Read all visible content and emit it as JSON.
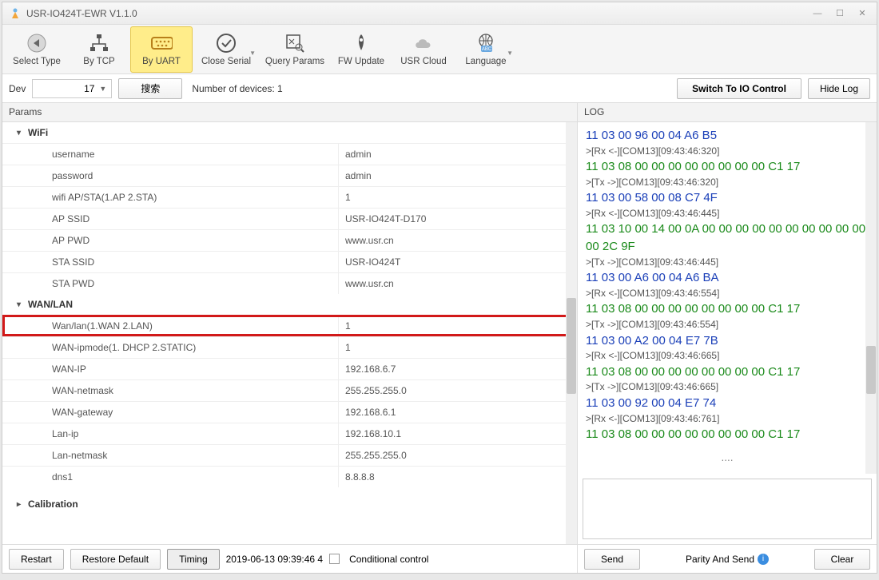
{
  "window": {
    "title": "USR-IO424T-EWR V1.1.0"
  },
  "ribbon": {
    "select_type": "Select Type",
    "by_tcp": "By TCP",
    "by_uart": "By UART",
    "close_serial": "Close Serial",
    "query_params": "Query Params",
    "fw_update": "FW Update",
    "usr_cloud": "USR Cloud",
    "language": "Language"
  },
  "secondbar": {
    "dev_label": "Dev",
    "dev_value": "17",
    "search_label": "搜索",
    "num_devices": "Number of devices: 1",
    "switch_io": "Switch To IO Control",
    "hide_log": "Hide Log"
  },
  "params": {
    "header": "Params",
    "wifi_group": "WiFi",
    "wanlan_group": "WAN/LAN",
    "calib_group": "Calibration",
    "wifi": [
      {
        "label": "username",
        "value": "admin"
      },
      {
        "label": "password",
        "value": "admin"
      },
      {
        "label": "wifi AP/STA(1.AP 2.STA)",
        "value": "1"
      },
      {
        "label": "AP SSID",
        "value": "USR-IO424T-D170"
      },
      {
        "label": "AP PWD",
        "value": "www.usr.cn"
      },
      {
        "label": "STA SSID",
        "value": "USR-IO424T"
      },
      {
        "label": "STA PWD",
        "value": "www.usr.cn"
      }
    ],
    "wanlan": [
      {
        "label": "Wan/lan(1.WAN 2.LAN)",
        "value": "1",
        "highlight": true
      },
      {
        "label": "WAN-ipmode(1. DHCP 2.STATIC)",
        "value": "1"
      },
      {
        "label": "WAN-IP",
        "value": "192.168.6.7"
      },
      {
        "label": "WAN-netmask",
        "value": "255.255.255.0"
      },
      {
        "label": "WAN-gateway",
        "value": "192.168.6.1"
      },
      {
        "label": "Lan-ip",
        "value": "192.168.10.1"
      },
      {
        "label": "Lan-netmask",
        "value": "255.255.255.0"
      },
      {
        "label": "dns1",
        "value": "8.8.8.8"
      }
    ]
  },
  "bottombar": {
    "restart": "Restart",
    "restore": "Restore Default",
    "timing": "Timing",
    "timestamp": "2019-06-13 09:39:46 4",
    "cond_ctrl": "Conditional control"
  },
  "log": {
    "header": "LOG",
    "lines": [
      {
        "cls": "log-hex",
        "text": "11 03 00 96 00 04 A6 B5"
      },
      {
        "cls": "log-meta",
        "text": ">[Rx <-][COM13][09:43:46:320]"
      },
      {
        "cls": "log-hex-green",
        "text": "11 03 08 00 00 00 00 00 00 00 00 C1 17"
      },
      {
        "cls": "log-meta",
        "text": ">[Tx ->][COM13][09:43:46:320]"
      },
      {
        "cls": "log-hex",
        "text": "11 03 00 58 00 08 C7 4F"
      },
      {
        "cls": "log-meta",
        "text": ">[Rx <-][COM13][09:43:46:445]"
      },
      {
        "cls": "log-hex-green",
        "text": "11 03 10 00 14 00 0A 00 00 00 00 00 00 00 00 00 00 00 2C 9F"
      },
      {
        "cls": "log-meta",
        "text": ">[Tx ->][COM13][09:43:46:445]"
      },
      {
        "cls": "log-hex",
        "text": "11 03 00 A6 00 04 A6 BA"
      },
      {
        "cls": "log-meta",
        "text": ">[Rx <-][COM13][09:43:46:554]"
      },
      {
        "cls": "log-hex-green",
        "text": "11 03 08 00 00 00 00 00 00 00 00 C1 17"
      },
      {
        "cls": "log-meta",
        "text": ">[Tx ->][COM13][09:43:46:554]"
      },
      {
        "cls": "log-hex",
        "text": "11 03 00 A2 00 04 E7 7B"
      },
      {
        "cls": "log-meta",
        "text": ">[Rx <-][COM13][09:43:46:665]"
      },
      {
        "cls": "log-hex-green",
        "text": "11 03 08 00 00 00 00 00 00 00 00 C1 17"
      },
      {
        "cls": "log-meta",
        "text": ">[Tx ->][COM13][09:43:46:665]"
      },
      {
        "cls": "log-hex",
        "text": "11 03 00 92 00 04 E7 74"
      },
      {
        "cls": "log-meta",
        "text": ">[Rx <-][COM13][09:43:46:761]"
      },
      {
        "cls": "log-hex-green",
        "text": "11 03 08 00 00 00 00 00 00 00 00 C1 17"
      }
    ],
    "dots": "....",
    "send": "Send",
    "parity_send": "Parity And Send",
    "clear": "Clear"
  }
}
